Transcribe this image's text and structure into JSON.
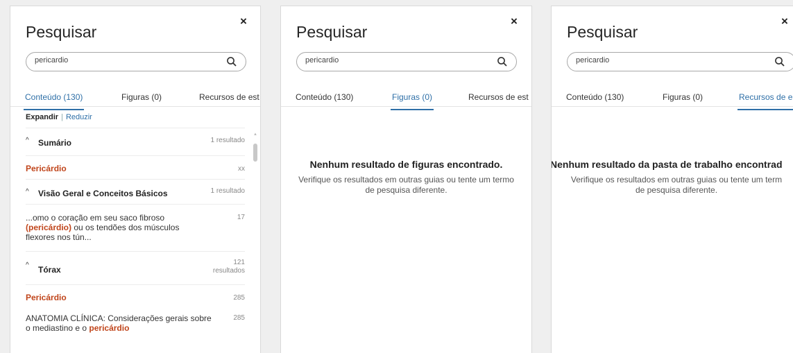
{
  "panels": [
    {
      "title": "Pesquisar",
      "close_label": "×",
      "search": {
        "value": "pericardio"
      },
      "tabs": [
        "Conteúdo (130)",
        "Figuras (0)",
        "Recursos de est"
      ],
      "active_tab": 0,
      "expand_label": "Expandir",
      "separator": "|",
      "collapse_label": "Reduzir",
      "results": {
        "section1": {
          "title": "Sumário",
          "count": "1 resultado"
        },
        "item1": {
          "label": "Pericárdio",
          "page": "xx"
        },
        "section2": {
          "title": "Visão Geral e Conceitos Básicos",
          "count": "1 resultado"
        },
        "item2": {
          "before": "...omo o coração em seu saco fibroso ",
          "highlight": "(pericárdio)",
          "after": " ou os tendões dos músculos flexores nos tún...",
          "page": "17"
        },
        "section3": {
          "title": "Tórax",
          "count_line1": "121",
          "count_line2": "resultados"
        },
        "item3": {
          "label": "Pericárdio",
          "page": "285"
        },
        "item4": {
          "before": "ANATOMIA CLÍNICA: Considerações gerais sobre o mediastino e o ",
          "highlight": "pericárdio",
          "page": "285"
        }
      }
    },
    {
      "title": "Pesquisar",
      "close_label": "×",
      "search": {
        "value": "pericardio"
      },
      "tabs": [
        "Conteúdo (130)",
        "Figuras (0)",
        "Recursos de est"
      ],
      "active_tab": 1,
      "empty_title": "Nenhum resultado de figuras encontrado.",
      "empty_sub_line1": "Verifique os resultados em outras guias ou tente um termo",
      "empty_sub_line2": "de pesquisa diferente."
    },
    {
      "title": "Pesquisar",
      "close_label": "×",
      "search": {
        "value": "pericardio"
      },
      "tabs": [
        "Conteúdo (130)",
        "Figuras (0)",
        "Recursos de e"
      ],
      "active_tab": 2,
      "empty_title": "Nenhum resultado da pasta de trabalho encontrad",
      "empty_sub_line1": "Verifique os resultados em outras guias ou tente um term",
      "empty_sub_line2": "de pesquisa diferente."
    }
  ],
  "icons": {
    "search": "search-icon",
    "close": "close-icon",
    "chevron": "chevron-up-icon"
  },
  "colors": {
    "accent": "#2e6fa7",
    "highlight": "#c0451b"
  }
}
